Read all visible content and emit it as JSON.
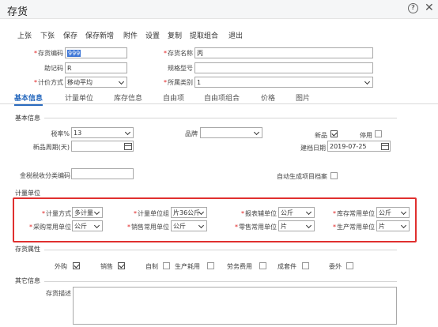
{
  "window": {
    "title": "存货",
    "help_label": "?",
    "close_label": "✕"
  },
  "toolbar": [
    "上张",
    "下张",
    "保存",
    "保存新增",
    "附件",
    "设置",
    "复制",
    "提取组合",
    "退出"
  ],
  "header_fields": {
    "code": {
      "label": "存货编码",
      "value": "999"
    },
    "name": {
      "label": "存货名称",
      "value": "丙"
    },
    "mnemonic": {
      "label": "助记码",
      "value": "R"
    },
    "spec": {
      "label": "规格型号",
      "value": ""
    },
    "valuation": {
      "label": "计价方式",
      "value": "移动平均"
    },
    "category": {
      "label": "所属类别",
      "value": "1"
    }
  },
  "tabs": [
    "基本信息",
    "计量单位",
    "库存信息",
    "自由项",
    "自由项组合",
    "价格",
    "图片"
  ],
  "basic": {
    "section_title": "基本信息",
    "tax_rate": {
      "label": "税率%",
      "value": "13"
    },
    "brand": {
      "label": "品牌",
      "value": ""
    },
    "new_product": {
      "label": "新品",
      "checked": true
    },
    "disabled": {
      "label": "停用",
      "checked": false
    },
    "new_period": {
      "label": "新品周期(天)",
      "value": ""
    },
    "create_date": {
      "label": "建档日期",
      "value": "2019-07-25"
    },
    "tax_code": {
      "label": "金税税收分类编码",
      "value": ""
    },
    "auto_gen": {
      "label": "自动生成项目档案",
      "checked": false
    }
  },
  "units": {
    "section_title": "计量单位",
    "row1": [
      {
        "label": "计量方式",
        "value": "多计量"
      },
      {
        "label": "计量单位组",
        "value": "片36公斤"
      },
      {
        "label": "报表辅单位",
        "value": "公斤"
      },
      {
        "label": "库存常用单位",
        "value": "公斤"
      }
    ],
    "row2": [
      {
        "label": "采购常用单位",
        "value": "公斤"
      },
      {
        "label": "销售常用单位",
        "value": "公斤"
      },
      {
        "label": "零售常用单位",
        "value": "片"
      },
      {
        "label": "生产常用单位",
        "value": "片"
      }
    ]
  },
  "attributes": {
    "section_title": "存货属性",
    "items": [
      {
        "label": "外购",
        "checked": true
      },
      {
        "label": "销售",
        "checked": true
      },
      {
        "label": "自制",
        "checked": false
      },
      {
        "label": "生产耗用",
        "checked": false
      },
      {
        "label": "劳务费用",
        "checked": false
      },
      {
        "label": "成套件",
        "checked": false
      },
      {
        "label": "委外",
        "checked": false
      }
    ]
  },
  "other": {
    "section_title": "其它信息",
    "desc_label": "存货描述",
    "desc_value": ""
  },
  "colors": {
    "accent": "#2a6bbf",
    "highlight_border": "#e0302f",
    "selection": "#3a74d6"
  }
}
